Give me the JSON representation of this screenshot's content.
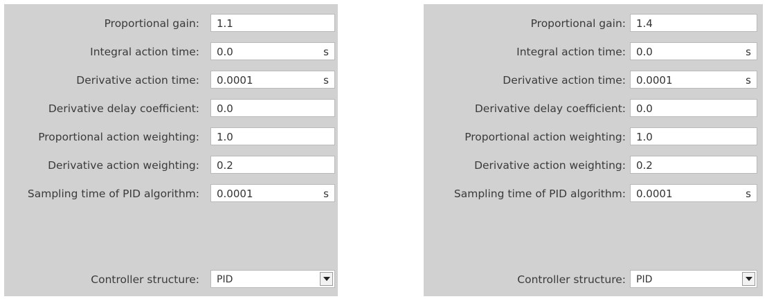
{
  "panels": [
    {
      "rows": [
        {
          "label": "Proportional gain:",
          "value": "1.1",
          "unit": ""
        },
        {
          "label": "Integral action time:",
          "value": "0.0",
          "unit": "s"
        },
        {
          "label": "Derivative action time:",
          "value": "0.0001",
          "unit": "s"
        },
        {
          "label": "Derivative delay coefficient:",
          "value": "0.0",
          "unit": ""
        },
        {
          "label": "Proportional action weighting:",
          "value": "1.0",
          "unit": ""
        },
        {
          "label": "Derivative action weighting:",
          "value": "0.2",
          "unit": ""
        },
        {
          "label": "Sampling time of PID algorithm:",
          "value": "0.0001",
          "unit": "s"
        }
      ],
      "controller": {
        "label": "Controller structure:",
        "value": "PID"
      }
    },
    {
      "rows": [
        {
          "label": "Proportional gain:",
          "value": "1.4",
          "unit": ""
        },
        {
          "label": "Integral action time:",
          "value": "0.0",
          "unit": "s"
        },
        {
          "label": "Derivative action time:",
          "value": "0.0001",
          "unit": "s"
        },
        {
          "label": "Derivative delay coefficient:",
          "value": "0.0",
          "unit": ""
        },
        {
          "label": "Proportional action weighting:",
          "value": "1.0",
          "unit": ""
        },
        {
          "label": "Derivative action weighting:",
          "value": "0.2",
          "unit": ""
        },
        {
          "label": "Sampling time of PID algorithm:",
          "value": "0.0001",
          "unit": "s"
        }
      ],
      "controller": {
        "label": "Controller structure:",
        "value": "PID"
      }
    }
  ],
  "colors": {
    "panel_bg": "#d1d1d1",
    "field_bg": "#ffffff",
    "field_border": "#b9b9b9"
  },
  "icons": {
    "dropdown": "chevron-down-icon"
  }
}
